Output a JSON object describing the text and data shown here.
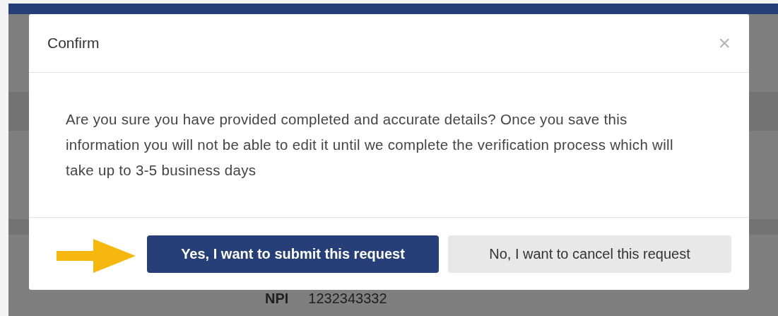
{
  "background": {
    "npi_label": "NPI",
    "npi_value": "1232343332"
  },
  "dialog": {
    "title": "Confirm",
    "close": "×",
    "message": "Are you sure you have provided completed and accurate details? Once you save this information you will not be able to edit it until we complete the verification process which will take up to 3-5 business days",
    "buttons": [
      {
        "label": "Yes, I want to submit this request",
        "kind": "primary"
      },
      {
        "label": "No, I want to cancel this request",
        "kind": "secondary"
      }
    ]
  }
}
